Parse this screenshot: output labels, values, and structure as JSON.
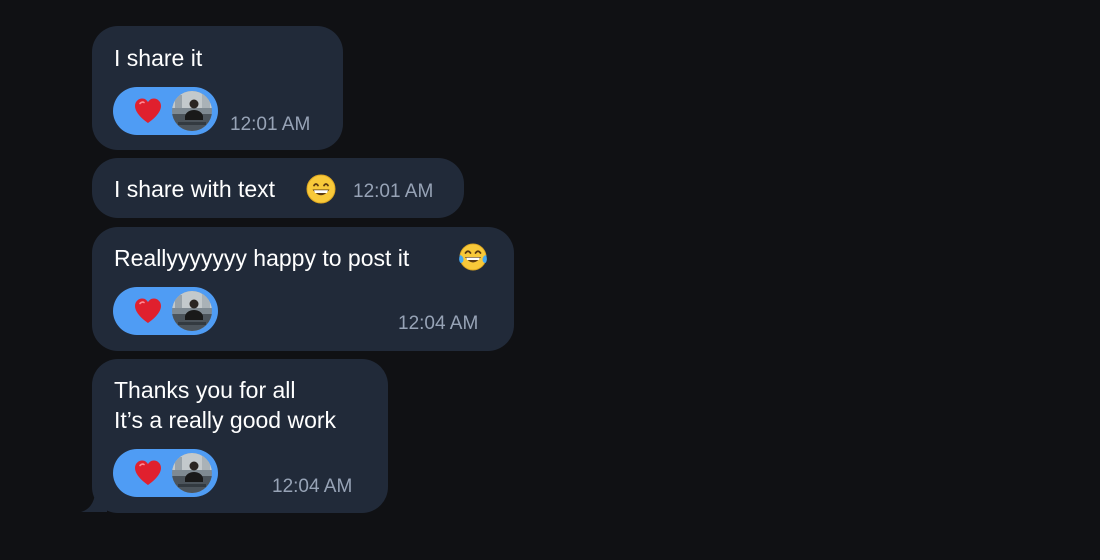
{
  "messages": [
    {
      "text": "I share it",
      "time": "12:01 AM",
      "reaction": {
        "emoji": "heart-icon",
        "color": "#e0202e",
        "has_avatar": true
      }
    },
    {
      "text": "I share with text",
      "emoji": "grinning-face-icon",
      "time": "12:01 AM"
    },
    {
      "text": "Reallyyyyyyy happy to post it",
      "emoji": "tears-of-joy-icon",
      "time": "12:04 AM",
      "reaction": {
        "emoji": "heart-icon",
        "color": "#e0202e",
        "has_avatar": true
      }
    },
    {
      "lines": [
        "Thanks you for all",
        "It’s a really good work"
      ],
      "time": "12:04 AM",
      "reaction": {
        "emoji": "heart-icon",
        "color": "#e0202e",
        "has_avatar": true
      }
    }
  ],
  "colors": {
    "background": "#101114",
    "bubble": "#212a39",
    "reaction_pill": "#4f9cf4",
    "timestamp": "#97a3b6"
  }
}
